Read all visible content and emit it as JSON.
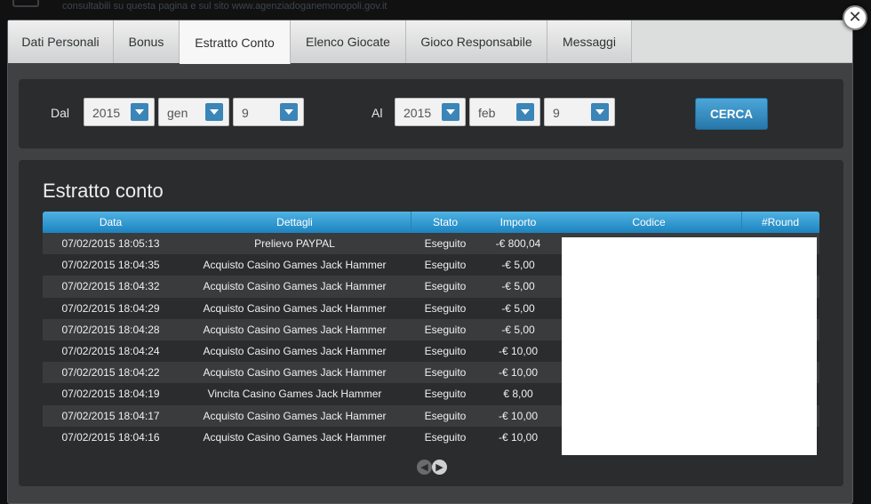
{
  "background": {
    "notice": "consultabili su questa pagina e sul sito www.agenziadoganemonopoli.gov.it"
  },
  "tabs": [
    {
      "label": "Dati Personali",
      "active": false
    },
    {
      "label": "Bonus",
      "active": false
    },
    {
      "label": "Estratto Conto",
      "active": true
    },
    {
      "label": "Elenco Giocate",
      "active": false
    },
    {
      "label": "Gioco Responsabile",
      "active": false
    },
    {
      "label": "Messaggi",
      "active": false
    }
  ],
  "close_icon": "close-icon",
  "filter": {
    "from_label": "Dal",
    "to_label": "Al",
    "from": {
      "year": "2015",
      "month": "gen",
      "day": "9"
    },
    "to": {
      "year": "2015",
      "month": "feb",
      "day": "9"
    },
    "search_label": "CERCA"
  },
  "results": {
    "title": "Estratto conto",
    "columns": [
      "Data",
      "Dettagli",
      "Stato",
      "Importo",
      "Codice",
      "#Round"
    ],
    "rows": [
      {
        "date": "07/02/2015 18:05:13",
        "details": "Prelievo PAYPAL",
        "status": "Eseguito",
        "amount": "-€ 800,04"
      },
      {
        "date": "07/02/2015 18:04:35",
        "details": "Acquisto Casino Games Jack Hammer",
        "status": "Eseguito",
        "amount": "-€ 5,00"
      },
      {
        "date": "07/02/2015 18:04:32",
        "details": "Acquisto Casino Games Jack Hammer",
        "status": "Eseguito",
        "amount": "-€ 5,00"
      },
      {
        "date": "07/02/2015 18:04:29",
        "details": "Acquisto Casino Games Jack Hammer",
        "status": "Eseguito",
        "amount": "-€ 5,00"
      },
      {
        "date": "07/02/2015 18:04:28",
        "details": "Acquisto Casino Games Jack Hammer",
        "status": "Eseguito",
        "amount": "-€ 5,00"
      },
      {
        "date": "07/02/2015 18:04:24",
        "details": "Acquisto Casino Games Jack Hammer",
        "status": "Eseguito",
        "amount": "-€ 10,00"
      },
      {
        "date": "07/02/2015 18:04:22",
        "details": "Acquisto Casino Games Jack Hammer",
        "status": "Eseguito",
        "amount": "-€ 10,00"
      },
      {
        "date": "07/02/2015 18:04:19",
        "details": "Vincita Casino Games Jack Hammer",
        "status": "Eseguito",
        "amount": "€ 8,00"
      },
      {
        "date": "07/02/2015 18:04:17",
        "details": "Acquisto Casino Games Jack Hammer",
        "status": "Eseguito",
        "amount": "-€ 10,00"
      },
      {
        "date": "07/02/2015 18:04:16",
        "details": "Acquisto Casino Games Jack Hammer",
        "status": "Eseguito",
        "amount": "-€ 10,00"
      }
    ]
  },
  "pager": {
    "prev_icon": "arrow-left-icon",
    "next_icon": "arrow-right-icon"
  },
  "colors": {
    "accent": "#2a8cc7",
    "panel": "#2b2c2e",
    "tabbar": "#dcdddd"
  }
}
